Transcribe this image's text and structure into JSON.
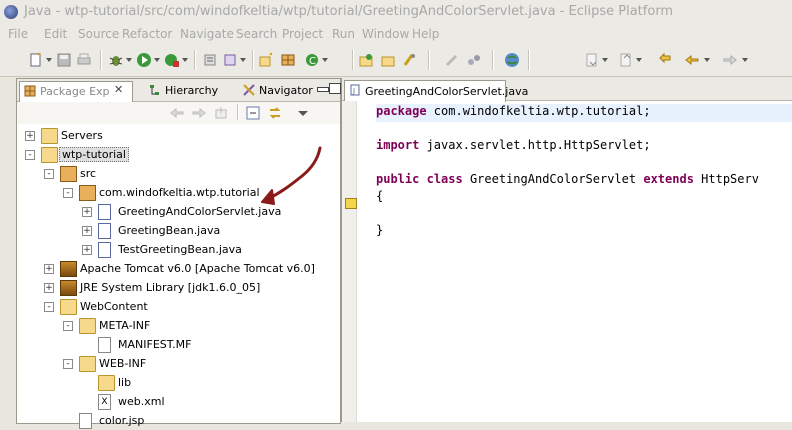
{
  "window": {
    "title": "Java - wtp-tutorial/src/com/windofkeltia/wtp/tutorial/GreetingAndColorServlet.java - Eclipse Platform"
  },
  "menu": [
    "File",
    "Edit",
    "Source",
    "Refactor",
    "Navigate",
    "Search",
    "Project",
    "Run",
    "Window",
    "Help"
  ],
  "left_view": {
    "tabs": [
      {
        "label": "Package Exp",
        "icon": "package-explorer-icon",
        "active": true
      },
      {
        "label": "Hierarchy",
        "icon": "hierarchy-icon",
        "active": false
      },
      {
        "label": "Navigator",
        "icon": "navigator-icon",
        "active": false
      }
    ]
  },
  "tree": [
    {
      "label": "Servers",
      "indent": 0,
      "expander": "+",
      "icon": "folder-icon"
    },
    {
      "label": "wtp-tutorial",
      "indent": 0,
      "expander": "-",
      "icon": "project-icon",
      "selected": true
    },
    {
      "label": "src",
      "indent": 1,
      "expander": "-",
      "icon": "source-folder-icon"
    },
    {
      "label": "com.windofkeltia.wtp.tutorial",
      "indent": 2,
      "expander": "-",
      "icon": "package-icon"
    },
    {
      "label": "GreetingAndColorServlet.java",
      "indent": 3,
      "expander": "+",
      "icon": "java-file-icon"
    },
    {
      "label": "GreetingBean.java",
      "indent": 3,
      "expander": "+",
      "icon": "java-file-icon"
    },
    {
      "label": "TestGreetingBean.java",
      "indent": 3,
      "expander": "+",
      "icon": "java-file-icon"
    },
    {
      "label": "Apache Tomcat v6.0 [Apache Tomcat v6.0]",
      "indent": 1,
      "expander": "+",
      "icon": "library-icon"
    },
    {
      "label": "JRE System Library [jdk1.6.0_05]",
      "indent": 1,
      "expander": "+",
      "icon": "library-icon"
    },
    {
      "label": "WebContent",
      "indent": 1,
      "expander": "-",
      "icon": "folder-icon"
    },
    {
      "label": "META-INF",
      "indent": 2,
      "expander": "-",
      "icon": "folder-icon"
    },
    {
      "label": "MANIFEST.MF",
      "indent": 3,
      "expander": "",
      "icon": "file-icon"
    },
    {
      "label": "WEB-INF",
      "indent": 2,
      "expander": "-",
      "icon": "folder-icon"
    },
    {
      "label": "lib",
      "indent": 3,
      "expander": "",
      "icon": "folder-icon"
    },
    {
      "label": "web.xml",
      "indent": 3,
      "expander": "",
      "icon": "xml-file-icon"
    },
    {
      "label": "color.jsp",
      "indent": 2,
      "expander": "",
      "icon": "file-icon"
    }
  ],
  "editor": {
    "tab": "GreetingAndColorServlet.java",
    "lines": [
      {
        "parts": [
          [
            "kw",
            "package"
          ],
          [
            "",
            " com.windofkeltia.wtp.tutorial;"
          ]
        ],
        "current": true
      },
      {
        "parts": []
      },
      {
        "parts": [
          [
            "kw",
            "import"
          ],
          [
            "",
            " javax.servlet.http.HttpServlet;"
          ]
        ]
      },
      {
        "parts": []
      },
      {
        "parts": [
          [
            "kw",
            "public"
          ],
          [
            "",
            " "
          ],
          [
            "kw",
            "class"
          ],
          [
            "",
            " GreetingAndColorServlet "
          ],
          [
            "kw",
            "extends"
          ],
          [
            "",
            " HttpServ"
          ]
        ]
      },
      {
        "parts": [
          [
            "",
            "{"
          ]
        ]
      },
      {
        "parts": []
      },
      {
        "parts": [
          [
            "",
            "}"
          ]
        ]
      }
    ]
  },
  "colors": {
    "keyword": "#7f0055",
    "annotation_arrow": "#8b1a1a",
    "current_line": "#e8f2fe"
  }
}
